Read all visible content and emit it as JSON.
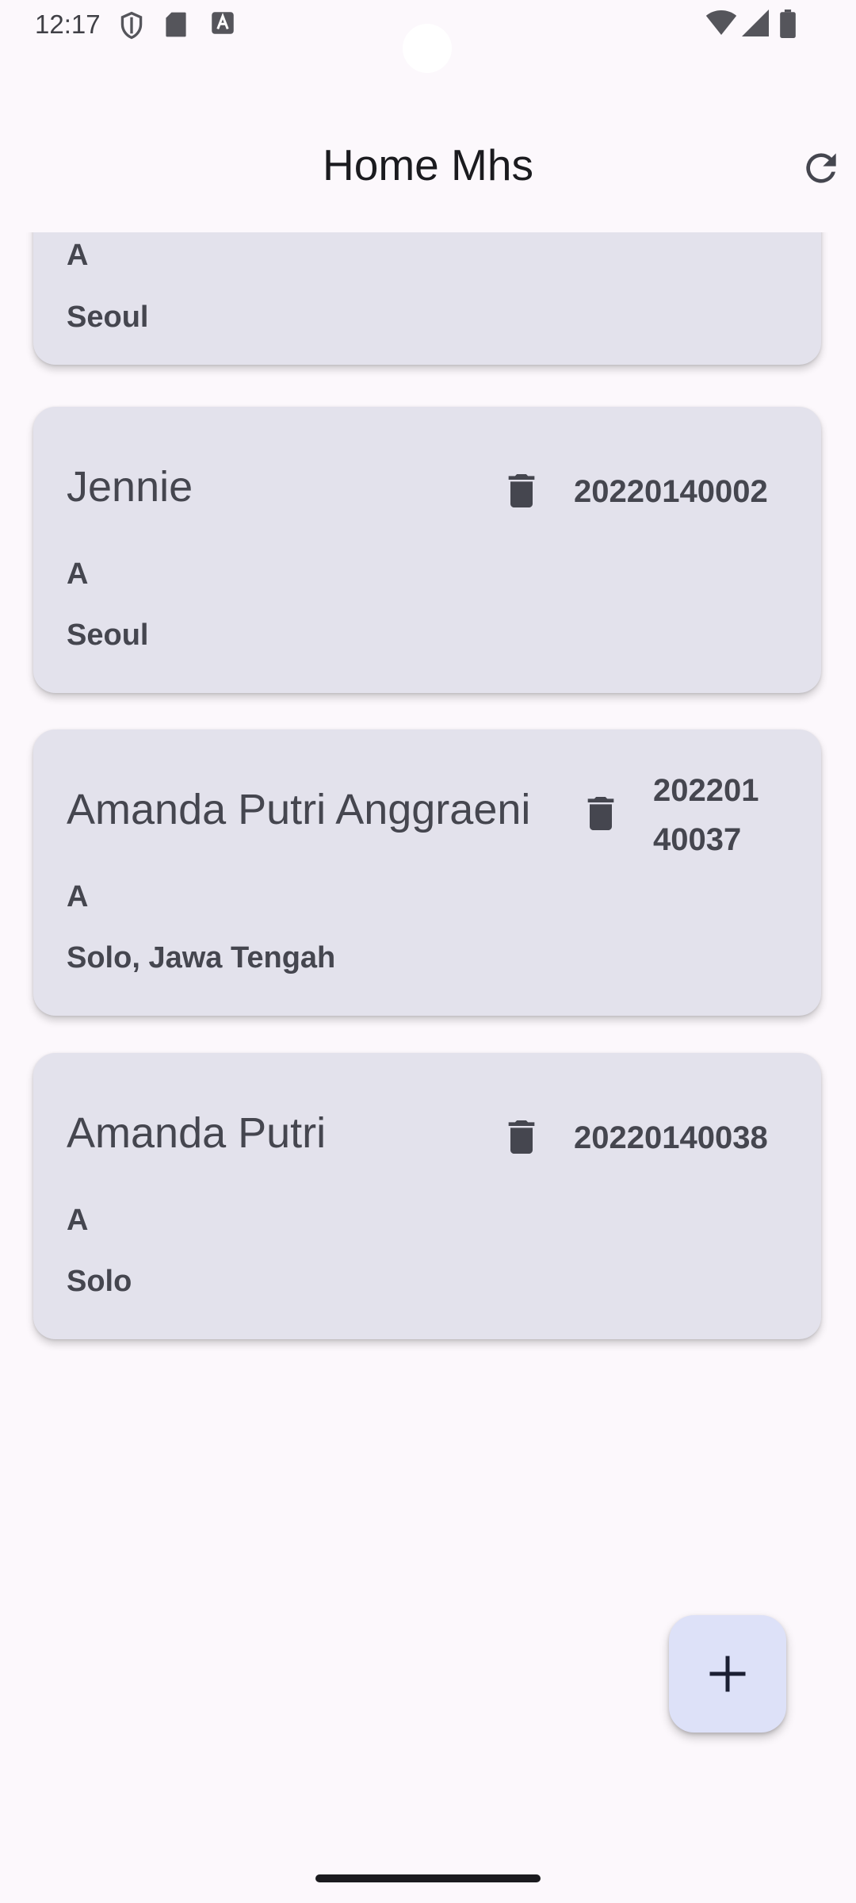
{
  "status_bar": {
    "time": "12:17",
    "left_icons": [
      "shield-icon",
      "sd-card-icon",
      "text-a-icon"
    ],
    "right_icons": [
      "wifi-icon",
      "cell-signal-icon",
      "battery-icon"
    ]
  },
  "app_bar": {
    "title": "Home Mhs",
    "action_icon": "refresh-icon"
  },
  "cards": [
    {
      "name": "",
      "nim": "",
      "kelas": "A",
      "alamat": "Seoul"
    },
    {
      "name": "Jennie",
      "nim": "20220140002",
      "kelas": "A",
      "alamat": "Seoul"
    },
    {
      "name": "Amanda Putri Anggraeni",
      "nim": "20220140037",
      "nim_line1": "202201",
      "nim_line2": "40037",
      "kelas": "A",
      "alamat": "Solo, Jawa Tengah"
    },
    {
      "name": "Amanda Putri",
      "nim": "20220140038",
      "kelas": "A",
      "alamat": "Solo"
    }
  ],
  "fab": {
    "icon": "plus-icon"
  },
  "colors": {
    "background": "#fcf8fc",
    "card": "#e3e2ec",
    "card_text": "#45464f",
    "fab": "#dde1f8"
  }
}
